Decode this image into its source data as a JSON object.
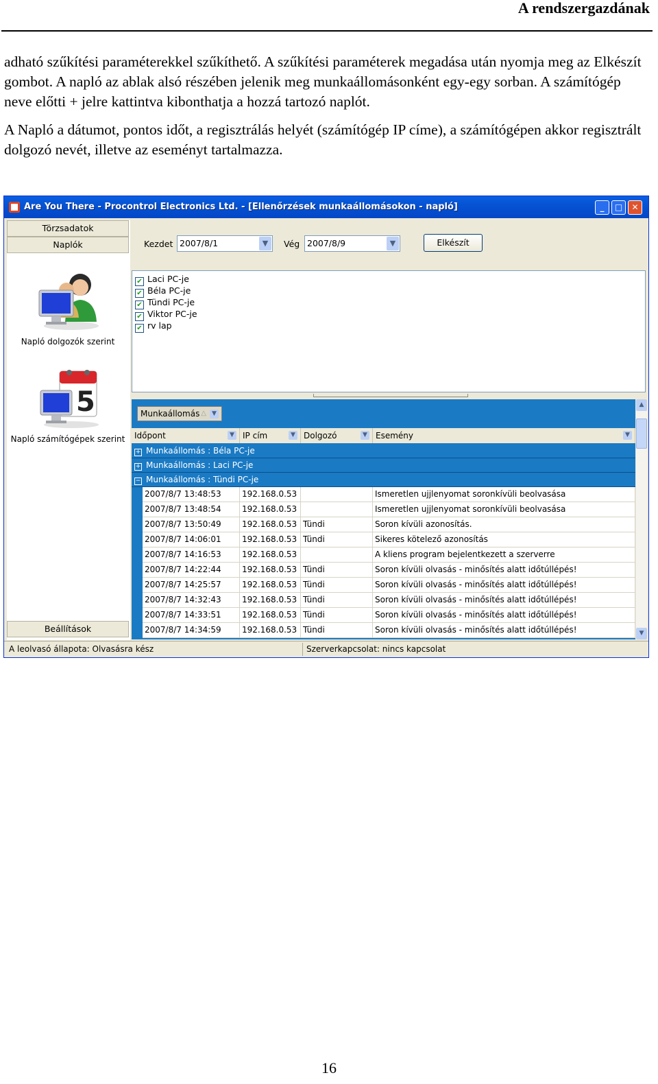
{
  "page": {
    "header": "A rendszergazdának",
    "paragraph1": "adható szűkítési paraméterekkel szűkíthető. A szűkítési paraméterek megadása után nyomja meg az Elkészít gombot. A napló az ablak alsó részében jelenik meg munkaállomásonként egy-egy sorban. A számítógép neve előtti + jelre kattintva kibonthatja a hozzá tartozó naplót.",
    "paragraph2": "A Napló a dátumot, pontos időt, a regisztrálás helyét (számítógép IP címe), a számítógépen akkor regisztrált dolgozó nevét, illetve az eseményt tartalmazza.",
    "page_number": "16"
  },
  "window": {
    "title": "Are You There - Procontrol Electronics Ltd. - [Ellenőrzések munkaállomásokon - napló]",
    "controls": {
      "minimize": "_",
      "maximize": "□",
      "close": "✕"
    }
  },
  "sidebar": {
    "top_buttons": [
      "Törzsadatok",
      "Naplók"
    ],
    "items": [
      {
        "label": "Napló dolgozók szerint",
        "icon": "users-monitor-icon"
      },
      {
        "label": "Napló számítógépek szerint",
        "icon": "calendar-monitor-icon",
        "calendar_digit": "5"
      }
    ],
    "settings": "Beállítások"
  },
  "toolbar": {
    "start_label": "Kezdet",
    "start_value": "2007/8/1",
    "end_label": "Vég",
    "end_value": "2007/8/9",
    "submit": "Elkészít"
  },
  "computers": [
    {
      "label": "Laci PC-je",
      "checked": true
    },
    {
      "label": "Béla PC-je",
      "checked": true
    },
    {
      "label": "Tündi PC-je",
      "checked": true
    },
    {
      "label": "Viktor PC-je",
      "checked": true
    },
    {
      "label": "rv lap",
      "checked": true
    }
  ],
  "grid": {
    "group_by": "Munkaállomás",
    "columns": [
      "Időpont",
      "IP cím",
      "Dolgozó",
      "Esemény"
    ],
    "groups": [
      {
        "label": "Munkaállomás : Béla PC-je",
        "expanded": false
      },
      {
        "label": "Munkaállomás : Laci PC-je",
        "expanded": false
      },
      {
        "label": "Munkaállomás : Tündi PC-je",
        "expanded": true
      }
    ],
    "rows": [
      [
        "2007/8/7 13:48:53",
        "192.168.0.53",
        "",
        "Ismeretlen ujjlenyomat soronkívüli beolvasása"
      ],
      [
        "2007/8/7 13:48:54",
        "192.168.0.53",
        "",
        "Ismeretlen ujjlenyomat soronkívüli beolvasása"
      ],
      [
        "2007/8/7 13:50:49",
        "192.168.0.53",
        "Tündi",
        "Soron kívüli azonosítás."
      ],
      [
        "2007/8/7 14:06:01",
        "192.168.0.53",
        "Tündi",
        "Sikeres kötelező azonosítás"
      ],
      [
        "2007/8/7 14:16:53",
        "192.168.0.53",
        "",
        "A kliens program bejelentkezett a szerverre"
      ],
      [
        "2007/8/7 14:22:44",
        "192.168.0.53",
        "Tündi",
        "Soron kívüli olvasás - minősítés alatt időtúllépés!"
      ],
      [
        "2007/8/7 14:25:57",
        "192.168.0.53",
        "Tündi",
        "Soron kívüli olvasás - minősítés alatt időtúllépés!"
      ],
      [
        "2007/8/7 14:32:43",
        "192.168.0.53",
        "Tündi",
        "Soron kívüli olvasás - minősítés alatt időtúllépés!"
      ],
      [
        "2007/8/7 14:33:51",
        "192.168.0.53",
        "Tündi",
        "Soron kívüli olvasás - minősítés alatt időtúllépés!"
      ],
      [
        "2007/8/7 14:34:59",
        "192.168.0.53",
        "Tündi",
        "Soron kívüli olvasás - minősítés alatt időtúllépés!"
      ]
    ]
  },
  "status": {
    "reader": "A leolvasó állapota: Olvasásra kész",
    "server": "Szerverkapcsolat: nincs kapcsolat"
  }
}
